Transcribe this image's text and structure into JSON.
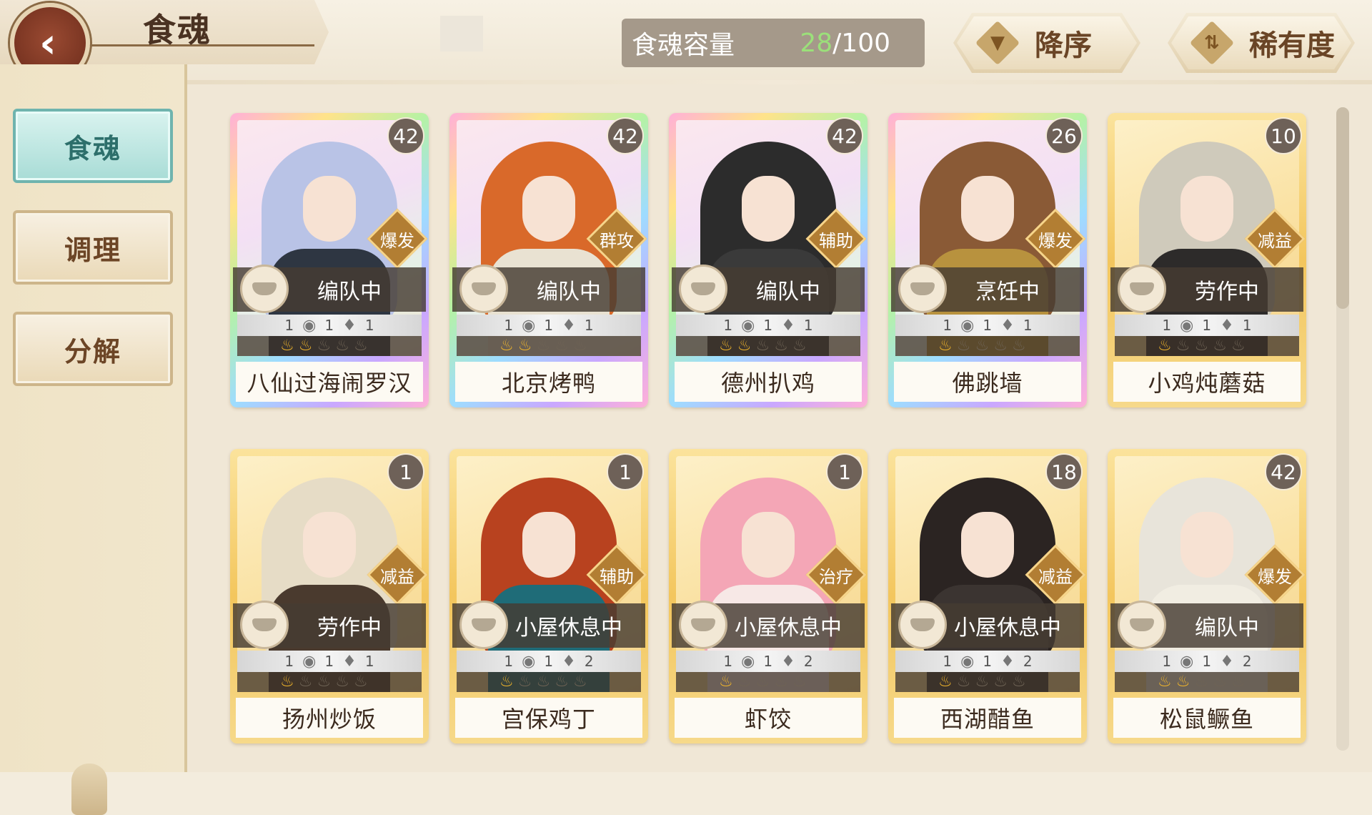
{
  "header": {
    "title": "食魂",
    "back_icon": "chevron-left-icon",
    "capacity_label": "食魂容量",
    "capacity_current": "28",
    "capacity_total": "/100",
    "sort_order_label": "降序",
    "sort_order_icon": "triangle-down-icon",
    "sort_key_label": "稀有度",
    "sort_key_icon": "swap-arrows-icon"
  },
  "sidebar": {
    "items": [
      {
        "label": "食魂",
        "active": true
      },
      {
        "label": "调理",
        "active": false
      },
      {
        "label": "分解",
        "active": false
      }
    ]
  },
  "cards": [
    {
      "name": "八仙过海闹罗汉",
      "level": "42",
      "role": "爆发",
      "status": "编队中",
      "stats": [
        "1",
        "1",
        "1"
      ],
      "flames_lit": 2,
      "flames_total": 5,
      "frame": "rainbow",
      "hair": "#b9c3e6",
      "outfit": "#2e3642"
    },
    {
      "name": "北京烤鸭",
      "level": "42",
      "role": "群攻",
      "status": "编队中",
      "stats": [
        "1",
        "1",
        "1"
      ],
      "flames_lit": 2,
      "flames_total": 5,
      "frame": "rainbow",
      "hair": "#d9692a",
      "outfit": "#e9e2d2"
    },
    {
      "name": "德州扒鸡",
      "level": "42",
      "role": "辅助",
      "status": "编队中",
      "stats": [
        "1",
        "1",
        "1"
      ],
      "flames_lit": 2,
      "flames_total": 5,
      "frame": "rainbow",
      "hair": "#2c2c2c",
      "outfit": "#3a3a3a"
    },
    {
      "name": "佛跳墙",
      "level": "26",
      "role": "爆发",
      "status": "烹饪中",
      "stats": [
        "1",
        "1",
        "1"
      ],
      "flames_lit": 1,
      "flames_total": 5,
      "frame": "rainbow",
      "hair": "#8a5a36",
      "outfit": "#b8923e"
    },
    {
      "name": "小鸡炖蘑菇",
      "level": "10",
      "role": "减益",
      "status": "劳作中",
      "stats": [
        "1",
        "1",
        "1"
      ],
      "flames_lit": 1,
      "flames_total": 5,
      "frame": "gold",
      "hair": "#cfcabb",
      "outfit": "#2d2b2a"
    },
    {
      "name": "扬州炒饭",
      "level": "1",
      "role": "减益",
      "status": "劳作中",
      "stats": [
        "1",
        "1",
        "1"
      ],
      "flames_lit": 1,
      "flames_total": 5,
      "frame": "gold",
      "hair": "#e6dcc6",
      "outfit": "#4a3a2e"
    },
    {
      "name": "宫保鸡丁",
      "level": "1",
      "role": "辅助",
      "status": "小屋休息中",
      "stats": [
        "1",
        "1",
        "2"
      ],
      "flames_lit": 1,
      "flames_total": 5,
      "frame": "gold",
      "hair": "#b8421f",
      "outfit": "#1f6c78"
    },
    {
      "name": "虾饺",
      "level": "1",
      "role": "治疗",
      "status": "小屋休息中",
      "stats": [
        "1",
        "1",
        "2"
      ],
      "flames_lit": 1,
      "flames_total": 5,
      "frame": "gold",
      "hair": "#f4a6b6",
      "outfit": "#f7e8e6"
    },
    {
      "name": "西湖醋鱼",
      "level": "18",
      "role": "减益",
      "status": "小屋休息中",
      "stats": [
        "1",
        "1",
        "2"
      ],
      "flames_lit": 1,
      "flames_total": 5,
      "frame": "gold",
      "hair": "#2b2422",
      "outfit": "#3b3431"
    },
    {
      "name": "松鼠鳜鱼",
      "level": "42",
      "role": "爆发",
      "status": "编队中",
      "stats": [
        "1",
        "1",
        "2"
      ],
      "flames_lit": 2,
      "flames_total": 5,
      "frame": "gold",
      "hair": "#e8e4da",
      "outfit": "#f1ede2"
    }
  ],
  "stat_icons": [
    "water-drop-icon",
    "flame-drop-icon"
  ],
  "colors": {
    "accent_teal": "#a8dcd6",
    "capacity_current": "#9be07a",
    "role_badge": "#b27e33",
    "back_button": "#7a3522"
  }
}
